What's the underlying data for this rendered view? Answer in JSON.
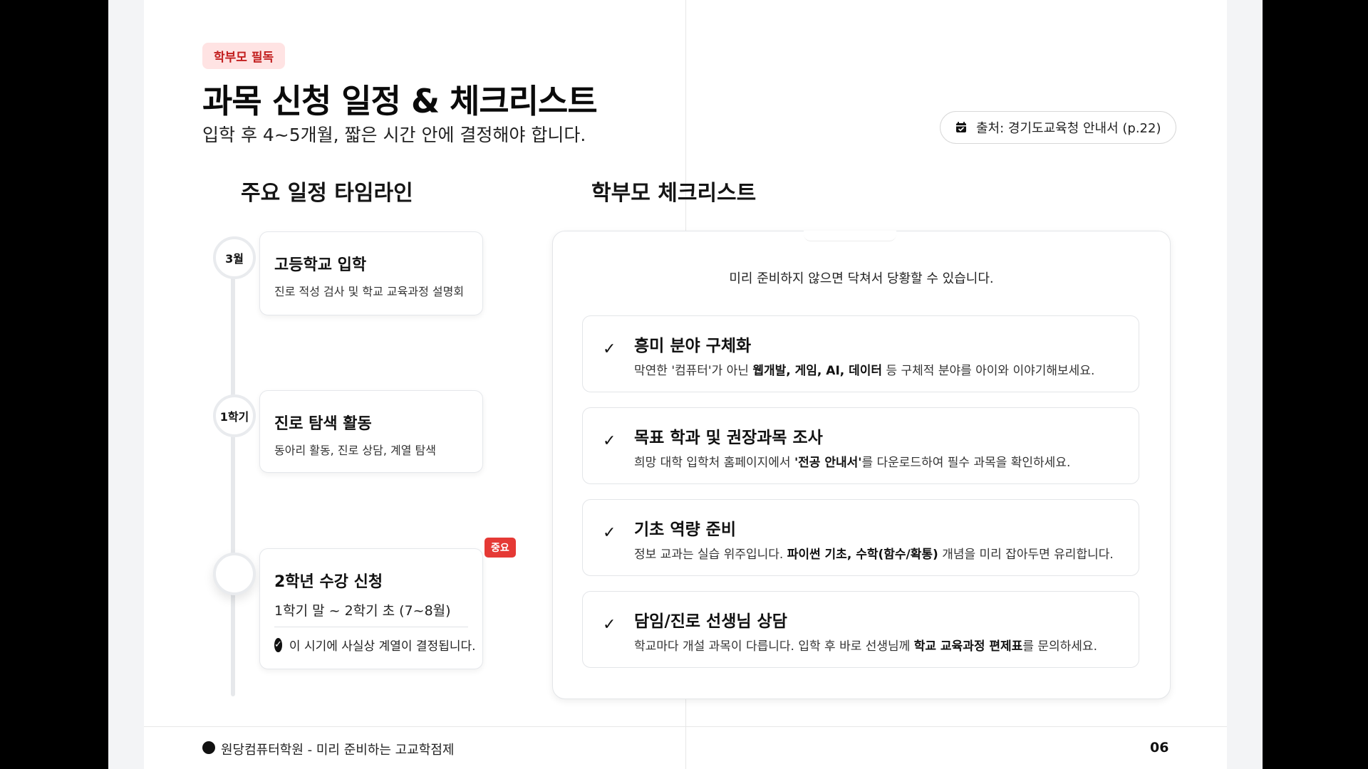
{
  "badge": "학부모 필독",
  "title": "과목 신청 일정 & 체크리스트",
  "subtitle": "입학 후 4~5개월, 짧은 시간 안에 결정해야 합니다.",
  "source": {
    "label": "출처: 경기도교육청 안내서 (p.22)",
    "icon": "calendar-check-icon"
  },
  "timeline": {
    "heading": "주요 일정 타임라인",
    "items": [
      {
        "marker": "3월",
        "title": "고등학교 입학",
        "desc": "진로 적성 검사 및 학교 교육과정 설명회"
      },
      {
        "marker": "1학기",
        "title": "진로 탐색 활동",
        "desc": "동아리 활동, 진로 상담, 계열 탐색"
      },
      {
        "marker": "",
        "title": "2학년 수강 신청",
        "badge": "중요",
        "sub": "1학기 말 ~ 2학기 초 (7~8월)",
        "note": "이 시기에 사실상 계열이 결정됩니다."
      }
    ]
  },
  "checklist": {
    "heading": "학부모 체크리스트",
    "intro": "미리 준비하지 않으면 닥쳐서 당황할 수 있습니다.",
    "items": [
      {
        "title": "흥미 분야 구체화",
        "desc_pre": "막연한 '컴퓨터'가 아닌 ",
        "desc_bold": "웹개발, 게임, AI, 데이터",
        "desc_post": " 등 구체적 분야를 아이와 이야기해보세요."
      },
      {
        "title": "목표 학과 및 권장과목 조사",
        "desc_pre": "희망 대학 입학처 홈페이지에서 ",
        "desc_bold": "'전공 안내서'",
        "desc_post": "를 다운로드하여 필수 과목을 확인하세요."
      },
      {
        "title": "기초 역량 준비",
        "desc_pre": "정보 교과는 실습 위주입니다. ",
        "desc_bold": "파이썬 기초, 수학(함수/확통)",
        "desc_post": " 개념을 미리 잡아두면 유리합니다."
      },
      {
        "title": "담임/진로 선생님 상담",
        "desc_pre": "학교마다 개설 과목이 다릅니다. 입학 후 바로 선생님께 ",
        "desc_bold": "학교 교육과정 편제표",
        "desc_post": "를 문의하세요."
      }
    ]
  },
  "footer": {
    "text": "원당컴퓨터학원 - 미리 준비하는 고교학점제",
    "page": "06"
  },
  "colors": {
    "accent": "#e53935",
    "badge_bg": "#ffe3e3",
    "badge_text": "#c21f1f"
  }
}
